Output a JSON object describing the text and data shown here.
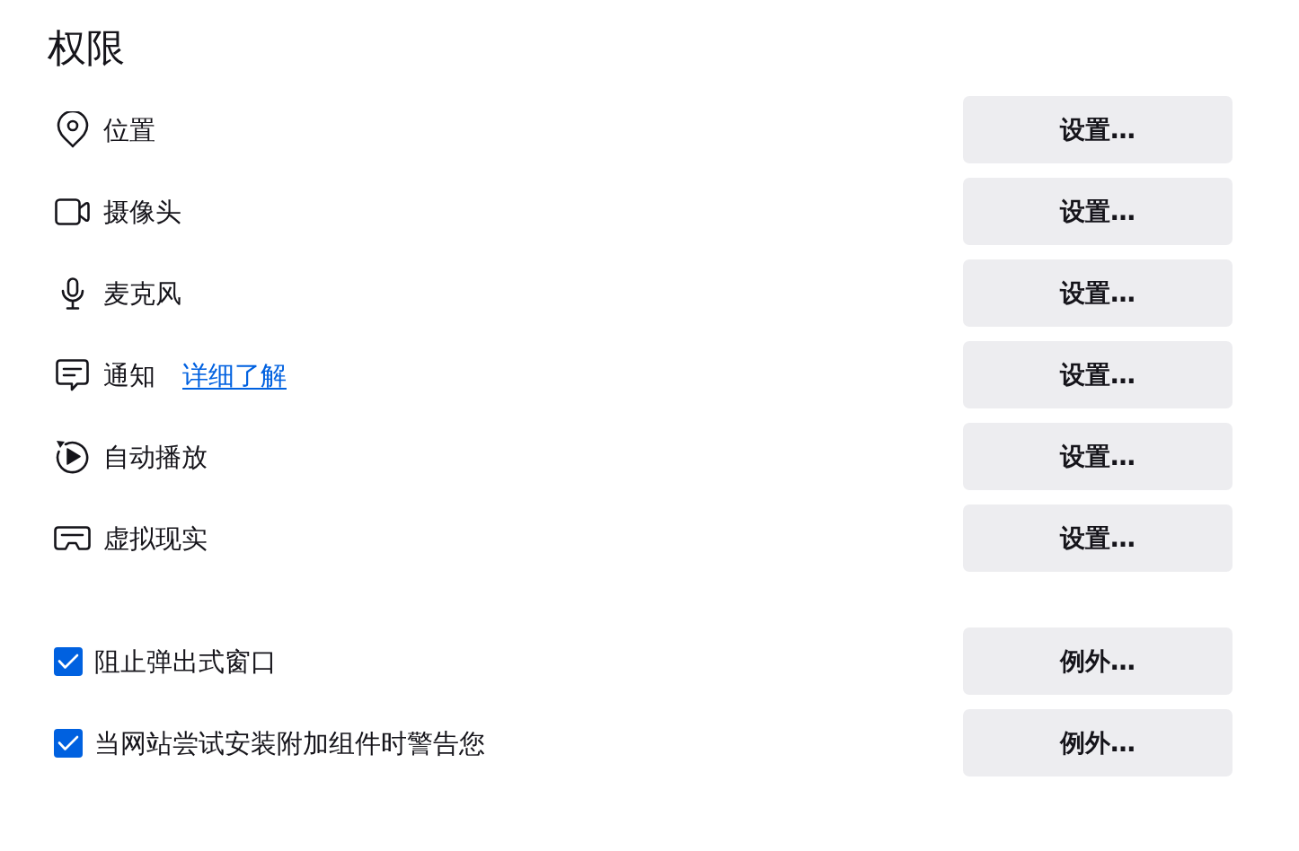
{
  "section": {
    "title": "权限"
  },
  "permissions": [
    {
      "label": "位置",
      "button": "设置…"
    },
    {
      "label": "摄像头",
      "button": "设置…"
    },
    {
      "label": "麦克风",
      "button": "设置…"
    },
    {
      "label": "通知",
      "link": "详细了解",
      "button": "设置…"
    },
    {
      "label": "自动播放",
      "button": "设置…"
    },
    {
      "label": "虚拟现实",
      "button": "设置…"
    }
  ],
  "options": [
    {
      "label": "阻止弹出式窗口",
      "checked": true,
      "button": "例外…"
    },
    {
      "label": "当网站尝试安装附加组件时警告您",
      "checked": true,
      "button": "例外…"
    }
  ]
}
